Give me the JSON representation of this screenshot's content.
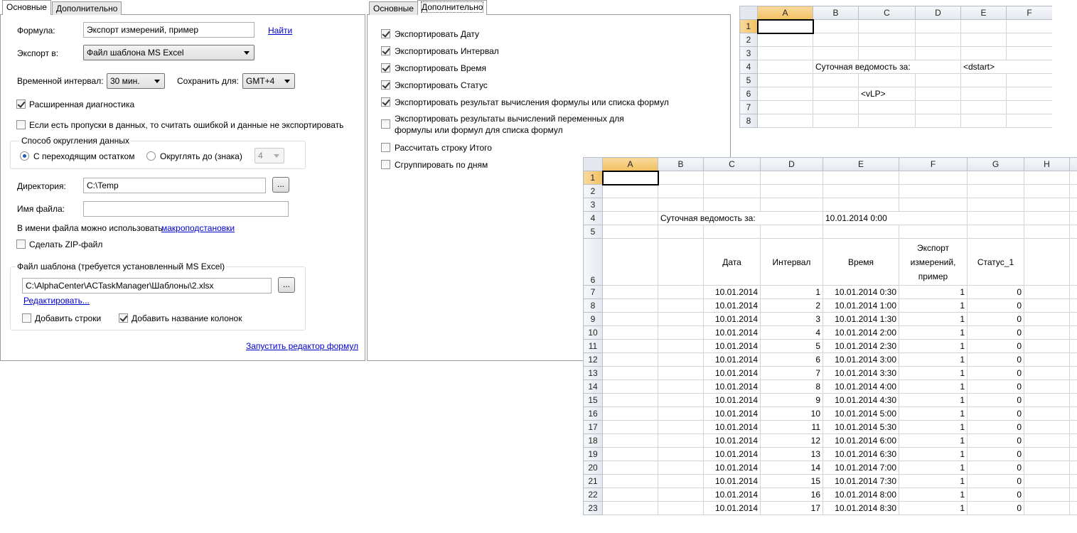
{
  "panel1": {
    "tabs": [
      "Основные",
      "Дополнительно"
    ],
    "formula_label": "Формула:",
    "formula_value": "Экспорт измерений, пример",
    "find_link": "Найти",
    "export_label": "Экспорт в:",
    "export_value": "Файл шаблона MS Excel",
    "interval_label": "Временной интервал:",
    "interval_value": "30 мин.",
    "save_for_label": "Сохранить для:",
    "save_for_value": "GMT+4",
    "ext_diag_label": "Расширенная диагностика",
    "ext_diag_checked": true,
    "gaps_label": "Если есть пропуски в данных, то считать ошибкой и данные не экспортировать",
    "gaps_checked": false,
    "rounding_group": "Способ округления данных",
    "rounding_opt1": "С переходящим остатком",
    "rounding_opt2": "Округлять до (знака)",
    "rounding_selected": "opt1",
    "rounding_digits": "4",
    "dir_label": "Директория:",
    "dir_value": "C:\\Temp",
    "browse_label": "...",
    "filename_label": "Имя файла:",
    "filename_value": "",
    "macro_hint": "В имени файла можно использовать",
    "macro_link": "макроподстановки",
    "zip_label": "Сделать ZIP-файл",
    "zip_checked": false,
    "template_group": "Файл шаблона (требуется установленный MS Excel)",
    "template_path": "C:\\AlphaCenter\\ACTaskManager\\Шаблоны\\2.xlsx",
    "edit_link": "Редактировать...",
    "add_rows_label": "Добавить строки",
    "add_rows_checked": false,
    "add_colnames_label": "Добавить название колонок",
    "add_colnames_checked": true,
    "formula_editor_link": "Запустить редактор формул"
  },
  "panel2": {
    "tabs": [
      "Основные",
      "Дополнительно"
    ],
    "options": [
      {
        "label": "Экспортировать Дату",
        "checked": true
      },
      {
        "label": "Экспортировать Интервал",
        "checked": true
      },
      {
        "label": "Экспортировать Время",
        "checked": true
      },
      {
        "label": "Экспортировать Статус",
        "checked": true
      },
      {
        "label": "Экспортировать результат вычисления формулы или списка формул",
        "checked": true
      },
      {
        "label": "Экспортировать результаты вычислений переменных для",
        "label2": "формулы или формул для списка формул",
        "checked": false
      },
      {
        "label": "Рассчитать строку Итого",
        "checked": false
      },
      {
        "label": "Сгруппировать по дням",
        "checked": false
      }
    ]
  },
  "sheet1": {
    "columns": [
      "A",
      "B",
      "C",
      "D",
      "E",
      "F"
    ],
    "rows": [
      "1",
      "2",
      "3",
      "4",
      "5",
      "6",
      "7",
      "8"
    ],
    "b4": "Суточная ведомость за:",
    "e4": "<dstart>",
    "c6": "<vLP>"
  },
  "sheet2": {
    "columns": [
      "A",
      "B",
      "C",
      "D",
      "E",
      "F",
      "G",
      "H"
    ],
    "b4": "Суточная ведомость за:",
    "e4": "10.01.2014 0:00",
    "headers": [
      "Дата",
      "Интервал",
      "Время",
      "Экспорт измерений, пример",
      "Статус_1"
    ],
    "header_lines": [
      [
        "Дата"
      ],
      [
        "Интервал"
      ],
      [
        "Время"
      ],
      [
        "Экспорт",
        "измерений,",
        "пример"
      ],
      [
        "Статус_1"
      ]
    ],
    "data": [
      {
        "row": "7",
        "date": "10.01.2014",
        "interval": "1",
        "time": "10.01.2014 0:30",
        "value": "1",
        "status": "0"
      },
      {
        "row": "8",
        "date": "10.01.2014",
        "interval": "2",
        "time": "10.01.2014 1:00",
        "value": "1",
        "status": "0"
      },
      {
        "row": "9",
        "date": "10.01.2014",
        "interval": "3",
        "time": "10.01.2014 1:30",
        "value": "1",
        "status": "0"
      },
      {
        "row": "10",
        "date": "10.01.2014",
        "interval": "4",
        "time": "10.01.2014 2:00",
        "value": "1",
        "status": "0"
      },
      {
        "row": "11",
        "date": "10.01.2014",
        "interval": "5",
        "time": "10.01.2014 2:30",
        "value": "1",
        "status": "0"
      },
      {
        "row": "12",
        "date": "10.01.2014",
        "interval": "6",
        "time": "10.01.2014 3:00",
        "value": "1",
        "status": "0"
      },
      {
        "row": "13",
        "date": "10.01.2014",
        "interval": "7",
        "time": "10.01.2014 3:30",
        "value": "1",
        "status": "0"
      },
      {
        "row": "14",
        "date": "10.01.2014",
        "interval": "8",
        "time": "10.01.2014 4:00",
        "value": "1",
        "status": "0"
      },
      {
        "row": "15",
        "date": "10.01.2014",
        "interval": "9",
        "time": "10.01.2014 4:30",
        "value": "1",
        "status": "0"
      },
      {
        "row": "16",
        "date": "10.01.2014",
        "interval": "10",
        "time": "10.01.2014 5:00",
        "value": "1",
        "status": "0"
      },
      {
        "row": "17",
        "date": "10.01.2014",
        "interval": "11",
        "time": "10.01.2014 5:30",
        "value": "1",
        "status": "0"
      },
      {
        "row": "18",
        "date": "10.01.2014",
        "interval": "12",
        "time": "10.01.2014 6:00",
        "value": "1",
        "status": "0"
      },
      {
        "row": "19",
        "date": "10.01.2014",
        "interval": "13",
        "time": "10.01.2014 6:30",
        "value": "1",
        "status": "0"
      },
      {
        "row": "20",
        "date": "10.01.2014",
        "interval": "14",
        "time": "10.01.2014 7:00",
        "value": "1",
        "status": "0"
      },
      {
        "row": "21",
        "date": "10.01.2014",
        "interval": "15",
        "time": "10.01.2014 7:30",
        "value": "1",
        "status": "0"
      },
      {
        "row": "22",
        "date": "10.01.2014",
        "interval": "16",
        "time": "10.01.2014 8:00",
        "value": "1",
        "status": "0"
      },
      {
        "row": "23",
        "date": "10.01.2014",
        "interval": "17",
        "time": "10.01.2014 8:30",
        "value": "1",
        "status": "0"
      }
    ]
  }
}
